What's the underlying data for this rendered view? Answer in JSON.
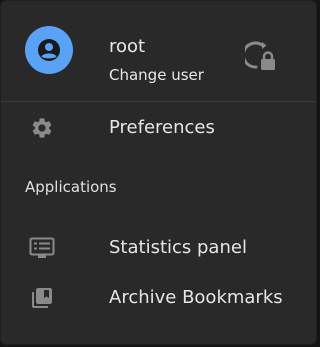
{
  "user": {
    "name": "root",
    "change_label": "Change user",
    "avatar_icon": "account-circle-icon",
    "lock_icon": "lock-reset-icon",
    "avatar_color": "#5aa2f5"
  },
  "menu": {
    "preferences_label": "Preferences",
    "preferences_icon": "gear-icon",
    "section_title": "Applications",
    "apps": [
      {
        "label": "Statistics panel",
        "icon": "statistics-panel-icon"
      },
      {
        "label": "Archive Bookmarks",
        "icon": "bookmarks-library-icon"
      }
    ]
  },
  "colors": {
    "background": "#292929",
    "text": "#e6e6e6",
    "icon": "#8a8a8a",
    "divider": "#3b3b3b"
  }
}
